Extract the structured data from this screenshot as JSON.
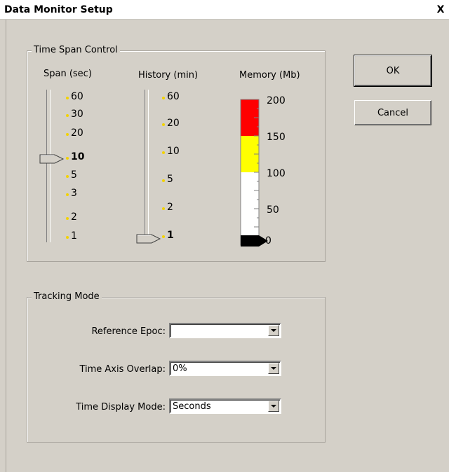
{
  "window": {
    "title": "Data Monitor Setup",
    "close_symbol": "X"
  },
  "buttons": {
    "ok": "OK",
    "cancel": "Cancel"
  },
  "time_span": {
    "legend": "Time Span Control",
    "span": {
      "label": "Span (sec)",
      "ticks": [
        "60",
        "30",
        "20",
        "10",
        "5",
        "3",
        "2",
        "1"
      ],
      "selected": "10"
    },
    "history": {
      "label": "History (min)",
      "ticks": [
        "60",
        "20",
        "10",
        "5",
        "2",
        "1"
      ],
      "selected": "1"
    },
    "memory": {
      "label": "Memory (Mb)",
      "scale": [
        "200",
        "150",
        "100",
        "50",
        "0"
      ],
      "value_mb": 0,
      "max_mb": 200,
      "colors": {
        "red": "#ff0000",
        "yellow": "#ffff00",
        "white": "#ffffff",
        "black": "#000000"
      }
    }
  },
  "tracking": {
    "legend": "Tracking Mode",
    "reference_epoc": {
      "label": "Reference Epoc:",
      "value": ""
    },
    "time_axis_overlap": {
      "label": "Time Axis Overlap:",
      "value": "0%"
    },
    "time_display_mode": {
      "label": "Time Display Mode:",
      "value": "Seconds"
    }
  }
}
